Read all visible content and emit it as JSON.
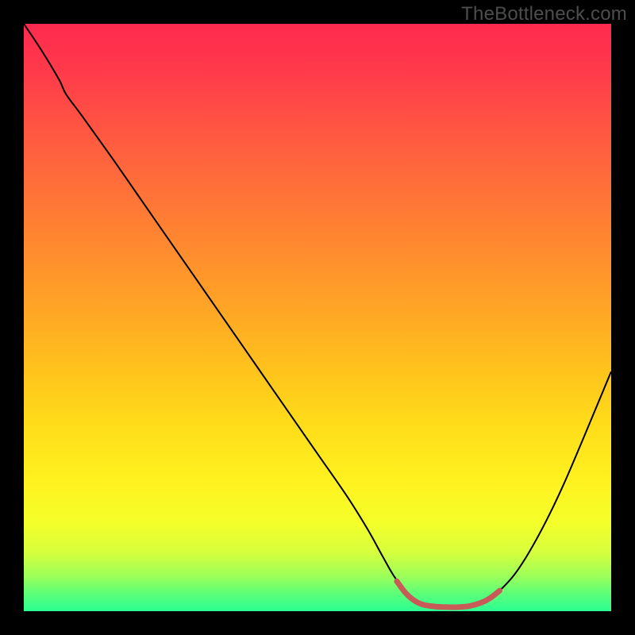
{
  "watermark": "TheBottleneck.com",
  "chart_data": {
    "type": "line",
    "title": "",
    "xlabel": "",
    "ylabel": "",
    "xlim": [
      0,
      1
    ],
    "ylim": [
      0,
      1
    ],
    "background": {
      "type": "vertical-gradient",
      "stops": [
        {
          "offset": 0.0,
          "color": "#ff2a4f"
        },
        {
          "offset": 0.08,
          "color": "#ff3a4a"
        },
        {
          "offset": 0.18,
          "color": "#ff5642"
        },
        {
          "offset": 0.28,
          "color": "#ff7039"
        },
        {
          "offset": 0.38,
          "color": "#ff8a2f"
        },
        {
          "offset": 0.48,
          "color": "#ffa426"
        },
        {
          "offset": 0.58,
          "color": "#ffc01d"
        },
        {
          "offset": 0.68,
          "color": "#ffdc1a"
        },
        {
          "offset": 0.78,
          "color": "#fff21f"
        },
        {
          "offset": 0.85,
          "color": "#f4ff2a"
        },
        {
          "offset": 0.9,
          "color": "#d6ff3d"
        },
        {
          "offset": 0.94,
          "color": "#9dff5a"
        },
        {
          "offset": 0.97,
          "color": "#5dff78"
        },
        {
          "offset": 1.0,
          "color": "#2bff93"
        }
      ]
    },
    "series": [
      {
        "name": "bottleneck-curve",
        "color": "#000000",
        "width": 2,
        "points": [
          {
            "x": 0.0,
            "y": 1.0
          },
          {
            "x": 0.03,
            "y": 0.955
          },
          {
            "x": 0.06,
            "y": 0.905
          },
          {
            "x": 0.072,
            "y": 0.88
          },
          {
            "x": 0.1,
            "y": 0.842
          },
          {
            "x": 0.15,
            "y": 0.772
          },
          {
            "x": 0.2,
            "y": 0.7
          },
          {
            "x": 0.25,
            "y": 0.628
          },
          {
            "x": 0.3,
            "y": 0.556
          },
          {
            "x": 0.35,
            "y": 0.484
          },
          {
            "x": 0.4,
            "y": 0.412
          },
          {
            "x": 0.45,
            "y": 0.34
          },
          {
            "x": 0.5,
            "y": 0.268
          },
          {
            "x": 0.55,
            "y": 0.196
          },
          {
            "x": 0.585,
            "y": 0.14
          },
          {
            "x": 0.61,
            "y": 0.095
          },
          {
            "x": 0.63,
            "y": 0.06
          },
          {
            "x": 0.65,
            "y": 0.034
          },
          {
            "x": 0.67,
            "y": 0.018
          },
          {
            "x": 0.69,
            "y": 0.01
          },
          {
            "x": 0.715,
            "y": 0.007
          },
          {
            "x": 0.74,
            "y": 0.007
          },
          {
            "x": 0.765,
            "y": 0.01
          },
          {
            "x": 0.79,
            "y": 0.02
          },
          {
            "x": 0.81,
            "y": 0.035
          },
          {
            "x": 0.835,
            "y": 0.062
          },
          {
            "x": 0.86,
            "y": 0.1
          },
          {
            "x": 0.89,
            "y": 0.155
          },
          {
            "x": 0.92,
            "y": 0.218
          },
          {
            "x": 0.955,
            "y": 0.3
          },
          {
            "x": 0.985,
            "y": 0.372
          },
          {
            "x": 1.0,
            "y": 0.408
          }
        ]
      },
      {
        "name": "highlight-segment",
        "color": "#c85a58",
        "width": 7,
        "linecap": "round",
        "points": [
          {
            "x": 0.635,
            "y": 0.051
          },
          {
            "x": 0.65,
            "y": 0.031
          },
          {
            "x": 0.665,
            "y": 0.018
          },
          {
            "x": 0.68,
            "y": 0.011
          },
          {
            "x": 0.7,
            "y": 0.008
          },
          {
            "x": 0.72,
            "y": 0.007
          },
          {
            "x": 0.74,
            "y": 0.007
          },
          {
            "x": 0.76,
            "y": 0.009
          },
          {
            "x": 0.78,
            "y": 0.015
          },
          {
            "x": 0.795,
            "y": 0.023
          },
          {
            "x": 0.81,
            "y": 0.035
          }
        ]
      }
    ]
  }
}
